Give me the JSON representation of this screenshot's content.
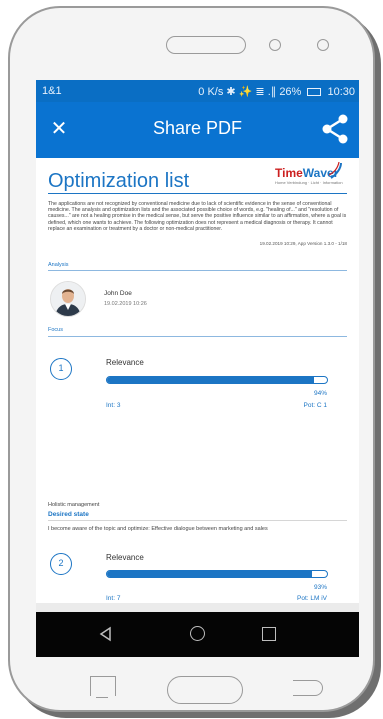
{
  "status_bar": {
    "carrier": "1&1",
    "indicators": "0 K/s ✱ ✨ ≣ .∥ 26%",
    "time": "10:30"
  },
  "app_bar": {
    "title": "Share PDF",
    "close_glyph": "✕"
  },
  "document": {
    "title": "Optimization list",
    "logo": {
      "brand_a": "Time",
      "brand_b": "Waver",
      "tagline": "Home Verbindung · Licht · Information"
    },
    "disclaimer": "The applications are not recognized by conventional medicine due to lack of scientific evidence in the sense of conventional medicine. The analysis and optimization lists and the associated possible choice of words, e.g. \"healing of...\" and \"resolution of causes...\" are not a healing promise in the medical sense, but serve the positive influence similar to an affirmation, where a goal is defined, which one wants to achieve. The following optimization does not represent a medical diagnosis or therapy. It cannot replace an examination or treatment by a doctor or non-medical practitioner.",
    "meta": "19.02.2019 10:29, App Version 1.3.0 - 1/18",
    "analysis_label": "Analysis",
    "person": {
      "name": "John Doe",
      "date": "19.02.2019 10:26"
    },
    "focus_label": "Focus",
    "items": [
      {
        "number": "1",
        "label": "Relevance",
        "percent_text": "94%",
        "relevance": 0.94,
        "int": "Int: 3",
        "pot": "Pot: C 1"
      },
      {
        "number": "2",
        "label": "Relevance",
        "percent_text": "93%",
        "relevance": 0.93,
        "int": "Int: 7",
        "pot": "Pot: LM iV"
      }
    ],
    "holistic_label": "Holistic management",
    "desired_state": "Desired state",
    "statement": "I become aware of the topic and optimize: Effective dialogue between marketing and sales"
  },
  "colors": {
    "accent": "#1c75c4",
    "appbar": "#0a73d1",
    "statusbar": "#0a6ec4"
  }
}
